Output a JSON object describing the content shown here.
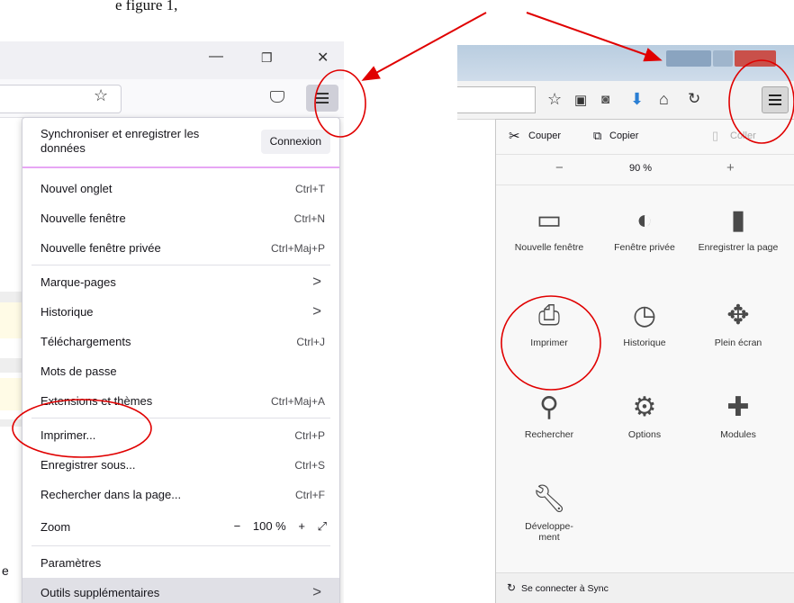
{
  "caption_fragment": "e figure 1,",
  "left_browser": {
    "window_controls": [
      "—",
      "❐",
      "✕"
    ],
    "toolbar_icons": [
      "star-icon",
      "pocket-icon",
      "hamburger-menu-icon"
    ],
    "side_text": "e",
    "menu": {
      "sync_label": "Synchroniser et enregistrer les données",
      "connect_button": "Connexion",
      "items": [
        {
          "label": "Nouvel onglet",
          "shortcut": "Ctrl+T"
        },
        {
          "label": "Nouvelle fenêtre",
          "shortcut": "Ctrl+N"
        },
        {
          "label": "Nouvelle fenêtre privée",
          "shortcut": "Ctrl+Maj+P"
        },
        {
          "label": "Marque-pages",
          "arrow": ">"
        },
        {
          "label": "Historique",
          "arrow": ">"
        },
        {
          "label": "Téléchargements",
          "shortcut": "Ctrl+J"
        },
        {
          "label": "Mots de passe"
        },
        {
          "label": "Extensions et thèmes",
          "shortcut": "Ctrl+Maj+A"
        },
        {
          "label": "Imprimer...",
          "shortcut": "Ctrl+P"
        },
        {
          "label": "Enregistrer sous...",
          "shortcut": "Ctrl+S"
        },
        {
          "label": "Rechercher dans la page...",
          "shortcut": "Ctrl+F"
        },
        {
          "label": "Paramètres"
        },
        {
          "label": "Outils supplémentaires",
          "arrow": ">"
        }
      ],
      "zoom": {
        "label": "Zoom",
        "minus": "−",
        "value": "100 %",
        "plus": "+",
        "fullscreen": "⤢"
      }
    }
  },
  "right_browser": {
    "toolbar_icons": [
      "star-icon",
      "clipboard-icon",
      "pocket-icon",
      "download-icon",
      "home-icon",
      "sync-icon",
      "hamburger-menu-icon"
    ],
    "edit": {
      "cut": "Couper",
      "copy": "Copier",
      "paste": "Coller"
    },
    "zoom": {
      "minus": "−",
      "value": "90 %",
      "plus": "+"
    },
    "tiles": [
      {
        "label": "Nouvelle fenêtre",
        "icon": "window-icon"
      },
      {
        "label": "Fenêtre privée",
        "icon": "mask-icon"
      },
      {
        "label": "Enregistrer la page",
        "icon": "page-icon"
      },
      {
        "label": "Imprimer",
        "icon": "printer-icon"
      },
      {
        "label": "Historique",
        "icon": "clock-icon"
      },
      {
        "label": "Plein écran",
        "icon": "fullscreen-icon"
      },
      {
        "label": "Rechercher",
        "icon": "magnifier-icon"
      },
      {
        "label": "Options",
        "icon": "gear-icon"
      },
      {
        "label": "Modules",
        "icon": "puzzle-icon"
      },
      {
        "label": "Développe-ment",
        "icon": "wrench-icon"
      }
    ],
    "sync_footer": "Se connecter à Sync"
  },
  "colors": {
    "annotation": "#e00000",
    "sync_underline": "#e7a6f4",
    "highlight": "#e0e0e6"
  }
}
